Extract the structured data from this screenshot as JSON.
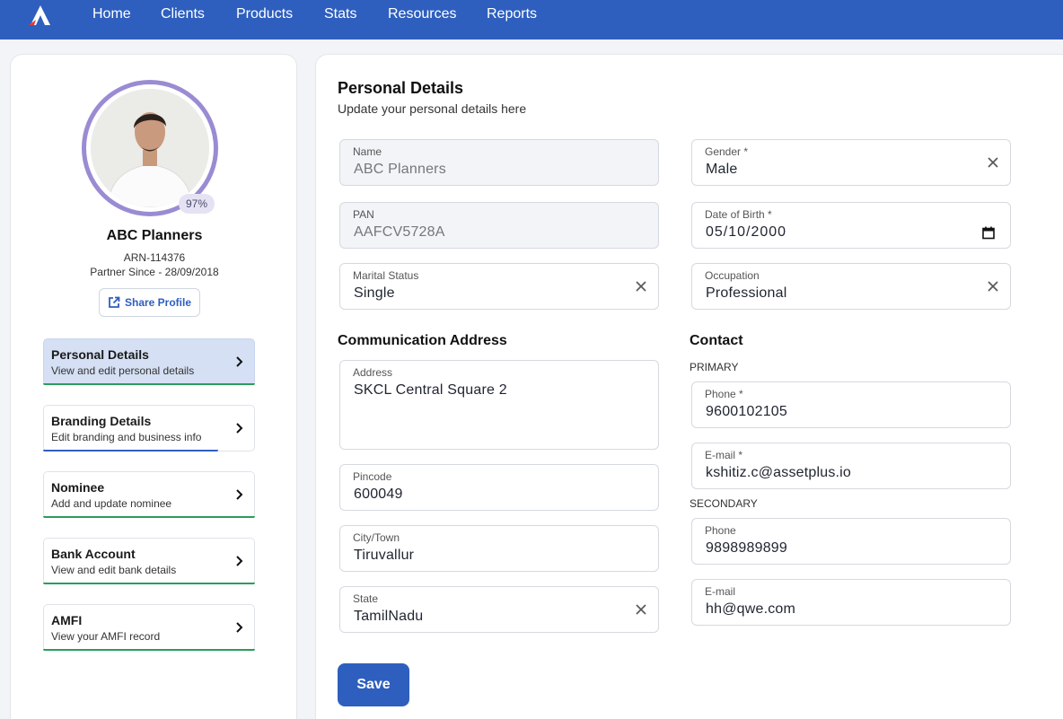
{
  "nav": {
    "items": [
      "Home",
      "Clients",
      "Products",
      "Stats",
      "Resources",
      "Reports"
    ]
  },
  "colors": {
    "brand": "#2e5fbe",
    "ring": "#9b8bd3",
    "active_tab": "#d5e0f4",
    "accent_green": "#2a9d5c"
  },
  "profile": {
    "completion": "97%",
    "name": "ABC Planners",
    "arn": "ARN-114376",
    "partner_since": "Partner Since - 28/09/2018",
    "share_label": "Share Profile"
  },
  "sidebar": {
    "items": [
      {
        "title": "Personal Details",
        "subtitle": "View and edit personal details"
      },
      {
        "title": "Branding Details",
        "subtitle": "Edit branding and business info"
      },
      {
        "title": "Nominee",
        "subtitle": "Add and update nominee"
      },
      {
        "title": "Bank Account",
        "subtitle": "View and edit bank details"
      },
      {
        "title": "AMFI",
        "subtitle": "View your AMFI record"
      }
    ]
  },
  "personal": {
    "title": "Personal Details",
    "subtitle": "Update your personal details here",
    "name": {
      "label": "Name",
      "value": "ABC Planners"
    },
    "gender": {
      "label": "Gender *",
      "value": "Male"
    },
    "pan": {
      "label": "PAN",
      "value": "AAFCV5728A"
    },
    "dob": {
      "label": "Date of Birth *",
      "value": "05/10/2000"
    },
    "marital": {
      "label": "Marital Status",
      "value": "Single"
    },
    "occupation": {
      "label": "Occupation",
      "value": "Professional"
    }
  },
  "address": {
    "title": "Communication Address",
    "address": {
      "label": "Address",
      "value": "SKCL Central Square 2"
    },
    "pincode": {
      "label": "Pincode",
      "value": "600049"
    },
    "city": {
      "label": "City/Town",
      "value": "Tiruvallur"
    },
    "state": {
      "label": "State",
      "value": "TamilNadu"
    }
  },
  "contact": {
    "title": "Contact",
    "primary_label": "PRIMARY",
    "secondary_label": "SECONDARY",
    "primary_phone": {
      "label": "Phone *",
      "value": "9600102105"
    },
    "primary_email": {
      "label": "E-mail *",
      "value": "kshitiz.c@assetplus.io"
    },
    "secondary_phone": {
      "label": "Phone",
      "value": "9898989899"
    },
    "secondary_email": {
      "label": "E-mail",
      "value": "hh@qwe.com"
    }
  },
  "actions": {
    "save_label": "Save"
  }
}
